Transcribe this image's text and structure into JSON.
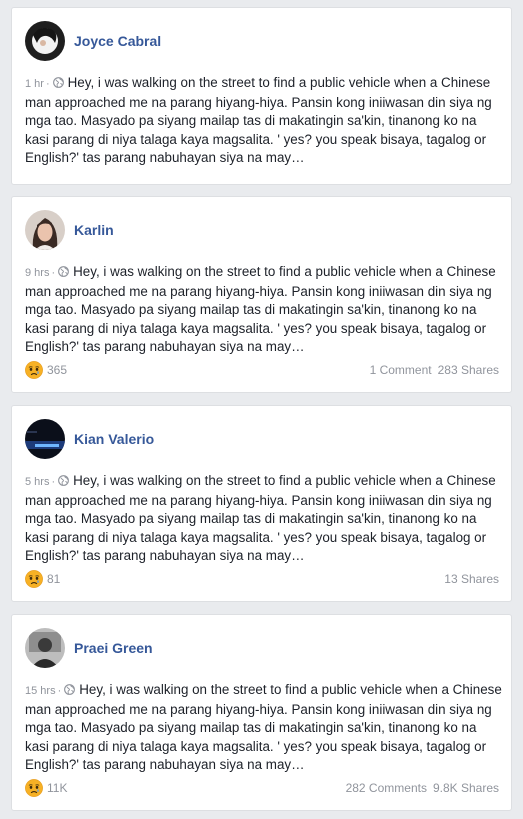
{
  "theme": {
    "background": "#e9ebee",
    "name_color": "#365899",
    "meta_color": "#90949c",
    "reaction_color": "#f7b125"
  },
  "posts": [
    {
      "author": "Joyce Cabral",
      "time": "1 hr",
      "privacy_icon": "globe-icon",
      "text": "Hey, i was walking on the street to find a public vehicle when a Chinese man approached me na parang hiyang-hiya. Pansin kong iniiwasan din siya ng mga tao. Masyado pa siyang mailap tas di makatingin sa'kin, tinanong ko na kasi parang di niya talaga kaya magsalita. ' yes? you speak bisaya, tagalog or English?' tas parang nabuhayan siya na may…"
    },
    {
      "author": "Karlin",
      "time": "9 hrs",
      "privacy_icon": "globe-icon",
      "text": "Hey, i was walking on the street to find a public vehicle when a Chinese man approached me na parang hiyang-hiya. Pansin kong iniiwasan din siya ng mga tao. Masyado pa siyang mailap tas di makatingin sa'kin, tinanong ko na kasi parang di niya talaga kaya magsalita. ' yes? you speak bisaya, tagalog or English?' tas parang nabuhayan siya na may…",
      "reaction_icon": "sad-reaction-icon",
      "reactions": "365",
      "comments": "1 Comment",
      "shares": "283 Shares"
    },
    {
      "author": "Kian Valerio",
      "time": "5 hrs",
      "privacy_icon": "globe-icon",
      "text": "Hey, i was walking on the street to find a public vehicle when a Chinese man approached me na parang hiyang-hiya. Pansin kong iniiwasan din siya ng mga tao. Masyado pa siyang mailap tas di makatingin sa'kin, tinanong ko na kasi parang di niya talaga kaya magsalita. ' yes? you speak bisaya, tagalog or English?' tas parang nabuhayan siya na may…",
      "reaction_icon": "sad-reaction-icon",
      "reactions": "81",
      "shares": "13 Shares"
    },
    {
      "author": "Praei Green",
      "time": "15 hrs",
      "privacy_icon": "globe-icon",
      "text": "Hey, i was walking on the street to find a public vehicle when a Chinese man approached me na parang hiyang-hiya. Pansin kong iniiwasan din siya ng mga tao. Masyado pa siyang mailap tas di makatingin sa'kin, tinanong ko na kasi parang di niya talaga kaya magsalita. ' yes? you speak bisaya, tagalog or English?' tas parang nabuhayan siya na may…",
      "reaction_icon": "sad-reaction-icon",
      "reactions": "11K",
      "comments": "282 Comments",
      "shares": "9.8K Shares"
    }
  ]
}
